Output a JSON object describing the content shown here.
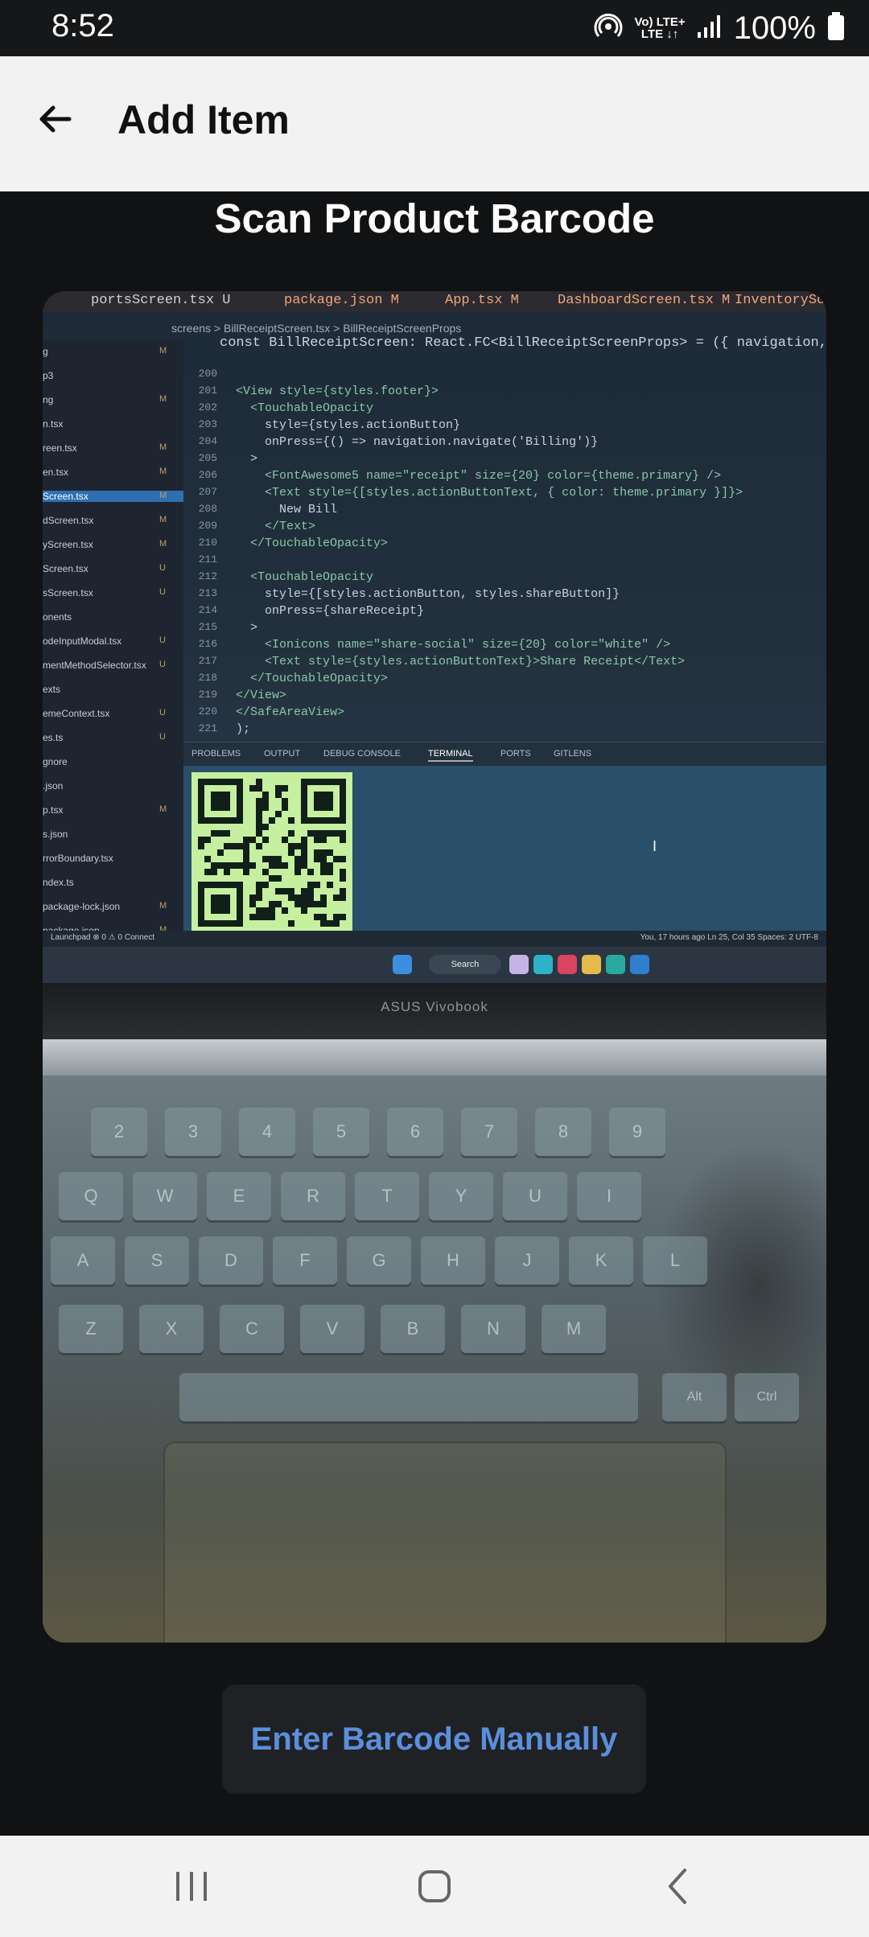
{
  "status_bar": {
    "time": "8:52",
    "network_top": "Vo) LTE+",
    "network_bottom": "LTE ↓↑",
    "battery": "100%"
  },
  "app_bar": {
    "back_icon": "arrow-left-icon",
    "title": "Add Item"
  },
  "scanner": {
    "title": "Scan Product Barcode",
    "manual_button_label": "Enter Barcode Manually"
  },
  "camera_preview": {
    "tabs": [
      "portsScreen.tsx U",
      "package.json M",
      "App.tsx M",
      "DashboardScreen.tsx M",
      "InventoryScre..."
    ],
    "breadcrumb": "screens > BillReceiptScreen.tsx > BillReceiptScreenProps",
    "signature": "const BillReceiptScreen: React.FC<BillReceiptScreenProps> = ({ navigation, route }) =>",
    "explorer": [
      {
        "name": "g",
        "badge": "M"
      },
      {
        "name": "p3",
        "badge": ""
      },
      {
        "name": "ng",
        "badge": "M"
      },
      {
        "name": "n.tsx",
        "badge": ""
      },
      {
        "name": "reen.tsx",
        "badge": "M"
      },
      {
        "name": "en.tsx",
        "badge": "M"
      },
      {
        "name": "Screen.tsx",
        "badge": "M"
      },
      {
        "name": "dScreen.tsx",
        "badge": "M"
      },
      {
        "name": "yScreen.tsx",
        "badge": "M"
      },
      {
        "name": "Screen.tsx",
        "badge": "U"
      },
      {
        "name": "sScreen.tsx",
        "badge": "U"
      },
      {
        "name": "onents",
        "badge": ""
      },
      {
        "name": "odeInputModal.tsx",
        "badge": "U"
      },
      {
        "name": "mentMethodSelector.tsx",
        "badge": "U"
      },
      {
        "name": "exts",
        "badge": ""
      },
      {
        "name": "emeContext.tsx",
        "badge": "U"
      },
      {
        "name": "es.ts",
        "badge": "U"
      },
      {
        "name": "gnore",
        "badge": ""
      },
      {
        "name": ".json",
        "badge": ""
      },
      {
        "name": "p.tsx",
        "badge": "M"
      },
      {
        "name": "s.json",
        "badge": ""
      },
      {
        "name": "rrorBoundary.tsx",
        "badge": ""
      },
      {
        "name": "ndex.ts",
        "badge": ""
      },
      {
        "name": "package-lock.json",
        "badge": "M"
      },
      {
        "name": "package.json",
        "badge": "M"
      }
    ],
    "line_numbers": [
      "200",
      "201",
      "202",
      "203",
      "204",
      "205",
      "206",
      "207",
      "208",
      "209",
      "210",
      "211",
      "212",
      "213",
      "214",
      "215",
      "216",
      "217",
      "218",
      "219",
      "220",
      "221"
    ],
    "code_lines": [
      "",
      "<View style={styles.footer}>",
      "  <TouchableOpacity",
      "    style={styles.actionButton}",
      "    onPress={() => navigation.navigate('Billing')}",
      "  >",
      "    <FontAwesome5 name=\"receipt\" size={20} color={theme.primary} />",
      "    <Text style={[styles.actionButtonText, { color: theme.primary }]}>",
      "      New Bill",
      "    </Text>",
      "  </TouchableOpacity>",
      "",
      "  <TouchableOpacity",
      "    style={[styles.actionButton, styles.shareButton]}",
      "    onPress={shareReceipt}",
      "  >",
      "    <Ionicons name=\"share-social\" size={20} color=\"white\" />",
      "    <Text style={styles.actionButtonText}>Share Receipt</Text>",
      "  </TouchableOpacity>",
      "</View>",
      "</SafeAreaView>",
      ");"
    ],
    "panel_tabs": [
      "PROBLEMS",
      "OUTPUT",
      "DEBUG CONSOLE",
      "TERMINAL",
      "PORTS",
      "GITLENS"
    ],
    "active_panel_tab": "TERMINAL",
    "status_left": "Launchpad  ⊗ 0 ⚠ 0   Connect",
    "status_right": "You, 17 hours ago   Ln 25, Col 35   Spaces: 2   UTF-8",
    "taskbar_search": "Search",
    "brand": "ASUS Vivobook",
    "keys": [
      "2",
      "3",
      "4",
      "5",
      "6",
      "7",
      "8",
      "9",
      "Q",
      "W",
      "E",
      "R",
      "T",
      "Y",
      "U",
      "I",
      "A",
      "S",
      "D",
      "F",
      "G",
      "H",
      "J",
      "K",
      "L",
      "Z",
      "X",
      "C",
      "V",
      "B",
      "N",
      "M",
      "Alt",
      "Ctrl"
    ]
  },
  "nav_bar": {
    "recents_icon": "recents-icon",
    "home_icon": "home-icon",
    "back_icon": "back-chevron-icon"
  },
  "colors": {
    "background": "#111214",
    "app_bar": "#f2f2f2",
    "manual_button_bg": "#202124",
    "manual_button_text": "#5b8fdc"
  }
}
